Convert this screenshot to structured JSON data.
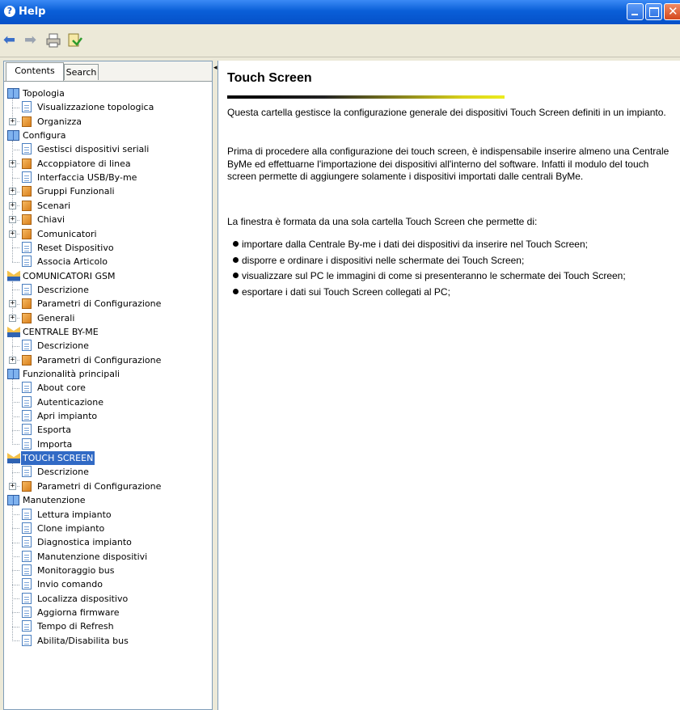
{
  "window": {
    "title": "Help"
  },
  "colors": {
    "titlebar": "#0a5fd8",
    "selection": "#316ac5",
    "accent_yellow": "#ecec1e"
  },
  "nav": {
    "tabs": [
      {
        "label": "Contents"
      },
      {
        "label": "Search"
      }
    ]
  },
  "tree": [
    {
      "label": "Topologia",
      "icon": "book",
      "level": 0
    },
    {
      "label": "Visualizzazione topologica",
      "icon": "page",
      "level": 1
    },
    {
      "label": "Organizza",
      "icon": "orange",
      "level": 1,
      "expander": "+"
    },
    {
      "label": "Configura",
      "icon": "book",
      "level": 0
    },
    {
      "label": "Gestisci dispositivi seriali",
      "icon": "page",
      "level": 1
    },
    {
      "label": "Accoppiatore di linea",
      "icon": "orange",
      "level": 1,
      "expander": "+"
    },
    {
      "label": "Interfaccia USB/By-me",
      "icon": "page",
      "level": 1
    },
    {
      "label": "Gruppi Funzionali",
      "icon": "orange",
      "level": 1,
      "expander": "+"
    },
    {
      "label": "Scenari",
      "icon": "orange",
      "level": 1,
      "expander": "+"
    },
    {
      "label": "Chiavi",
      "icon": "orange",
      "level": 1,
      "expander": "+"
    },
    {
      "label": "Comunicatori",
      "icon": "orange",
      "level": 1,
      "expander": "+"
    },
    {
      "label": "Reset Dispositivo",
      "icon": "page",
      "level": 1
    },
    {
      "label": "Associa Articolo",
      "icon": "page",
      "level": 1
    },
    {
      "label": "COMUNICATORI GSM",
      "icon": "open",
      "level": 0
    },
    {
      "label": "Descrizione",
      "icon": "page",
      "level": 1
    },
    {
      "label": "Parametri di Configurazione",
      "icon": "orange",
      "level": 1,
      "expander": "+"
    },
    {
      "label": "Generali",
      "icon": "orange",
      "level": 1,
      "expander": "+"
    },
    {
      "label": "CENTRALE BY-ME",
      "icon": "open",
      "level": 0
    },
    {
      "label": "Descrizione",
      "icon": "page",
      "level": 1
    },
    {
      "label": "Parametri di Configurazione",
      "icon": "orange",
      "level": 1,
      "expander": "+"
    },
    {
      "label": "Funzionalità principali",
      "icon": "book",
      "level": 0
    },
    {
      "label": "About core",
      "icon": "page",
      "level": 1
    },
    {
      "label": "Autenticazione",
      "icon": "page",
      "level": 1
    },
    {
      "label": "Apri impianto",
      "icon": "page",
      "level": 1
    },
    {
      "label": "Esporta",
      "icon": "page",
      "level": 1
    },
    {
      "label": "Importa",
      "icon": "page",
      "level": 1
    },
    {
      "label": "TOUCH SCREEN",
      "icon": "open",
      "level": 0,
      "selected": true
    },
    {
      "label": "Descrizione",
      "icon": "page",
      "level": 1
    },
    {
      "label": "Parametri di Configurazione",
      "icon": "orange",
      "level": 1,
      "expander": "+"
    },
    {
      "label": "Manutenzione",
      "icon": "book",
      "level": 0
    },
    {
      "label": "Lettura impianto",
      "icon": "page",
      "level": 1
    },
    {
      "label": "Clone impianto",
      "icon": "page",
      "level": 1
    },
    {
      "label": "Diagnostica impianto",
      "icon": "page",
      "level": 1
    },
    {
      "label": "Manutenzione dispositivi",
      "icon": "page",
      "level": 1
    },
    {
      "label": "Monitoraggio bus",
      "icon": "page",
      "level": 1
    },
    {
      "label": "Invio comando",
      "icon": "page",
      "level": 1
    },
    {
      "label": "Localizza dispositivo",
      "icon": "page",
      "level": 1
    },
    {
      "label": "Aggiorna firmware",
      "icon": "page",
      "level": 1
    },
    {
      "label": "Tempo di Refresh",
      "icon": "page",
      "level": 1
    },
    {
      "label": "Abilita/Disabilita bus",
      "icon": "page",
      "level": 1
    }
  ],
  "article": {
    "title": "Touch Screen",
    "paragraphs": [
      "Questa cartella gestisce la configurazione generale dei dispositivi Touch Screen definiti in un impianto.",
      "Prima di procedere alla configurazione dei touch screen, è indispensabile inserire almeno una Centrale ByMe ed effettuarne l'importazione dei dispositivi all'interno del software. Infatti il modulo del touch screen permette di aggiungere solamente i dispositivi importati dalle centrali ByMe.",
      "La finestra è formata da una sola cartella Touch Screen che permette di:"
    ],
    "bullets": [
      "importare dalla Centrale By-me i dati dei dispositivi da inserire nel Touch Screen;",
      "disporre e ordinare i dispositivi nelle schermate dei Touch Screen;",
      "visualizzare sul PC le immagini di come si presenteranno le schermate dei Touch Screen;",
      "esportare i dati sui Touch Screen collegati al PC;"
    ]
  }
}
